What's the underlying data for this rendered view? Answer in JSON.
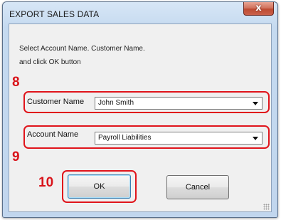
{
  "window": {
    "title": "EXPORT SALES DATA",
    "close_label": "x"
  },
  "instructions": {
    "line1": "Select Account Name.  Customer Name.",
    "line2": "and click OK button"
  },
  "annotations": {
    "step_customer": "8",
    "step_account": "9",
    "step_ok": "10",
    "color": "#e0141b"
  },
  "customer": {
    "label": "Customer Name",
    "value": "John Smith"
  },
  "account": {
    "label": "Account Name",
    "value": "Payroll Liabilities"
  },
  "buttons": {
    "ok": "OK",
    "cancel": "Cancel"
  }
}
